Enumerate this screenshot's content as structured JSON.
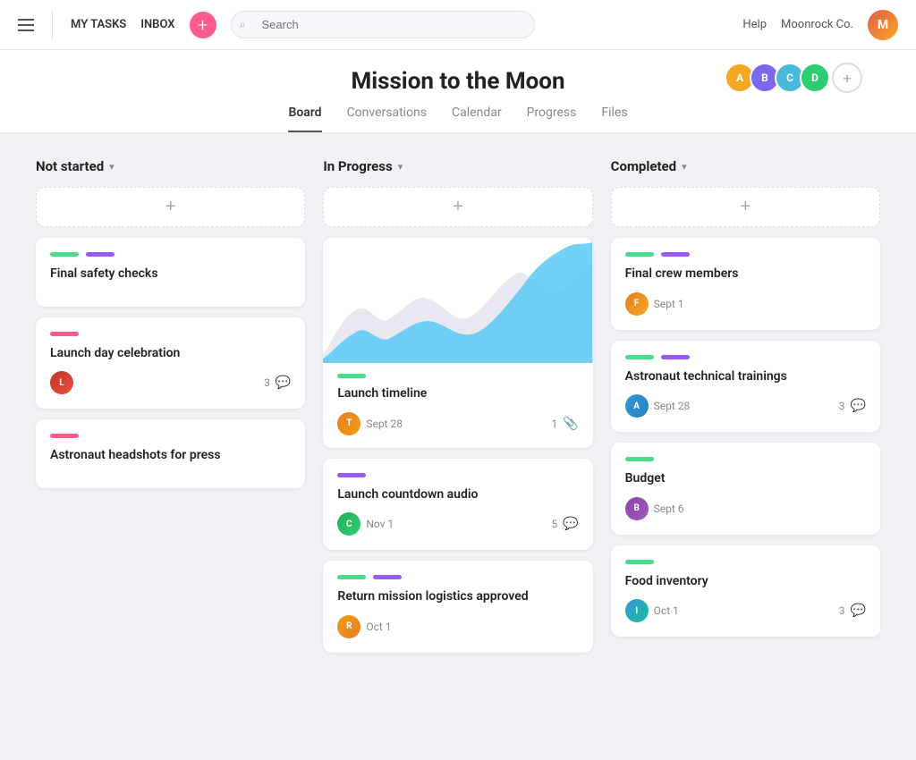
{
  "nav": {
    "my_tasks": "MY TASKS",
    "inbox": "INBOX",
    "add_icon": "+",
    "search_placeholder": "Search",
    "help": "Help",
    "company": "Moonrock Co.",
    "user_initials": "M"
  },
  "project": {
    "title": "Mission to the Moon",
    "tabs": [
      "Board",
      "Conversations",
      "Calendar",
      "Progress",
      "Files"
    ],
    "active_tab": 0,
    "avatars": [
      {
        "bg": "#f5a623",
        "initials": "A"
      },
      {
        "bg": "#7b68ee",
        "initials": "B"
      },
      {
        "bg": "#4ab8d8",
        "initials": "C"
      },
      {
        "bg": "#2ecc71",
        "initials": "D"
      }
    ]
  },
  "columns": [
    {
      "id": "not-started",
      "title": "Not started",
      "cards": [
        {
          "tags": [
            "green",
            "purple"
          ],
          "title": "Final safety checks",
          "avatar_bg": null,
          "date": null,
          "count": null,
          "icon": null
        },
        {
          "tags": [
            "pink"
          ],
          "title": "Launch day celebration",
          "avatar_bg": "#c0392b",
          "avatar_initials": "L",
          "date": null,
          "count": "3",
          "icon": "comment"
        },
        {
          "tags": [
            "pink"
          ],
          "title": "Astronaut headshots for press",
          "avatar_bg": null,
          "date": null,
          "count": null,
          "icon": null
        }
      ]
    },
    {
      "id": "in-progress",
      "title": "In Progress",
      "cards": [
        {
          "type": "chart",
          "tags": [
            "green"
          ],
          "title": "Launch timeline",
          "avatar_bg": "#e67e22",
          "avatar_initials": "T",
          "date": "Sept 28",
          "count": "1",
          "icon": "attach"
        },
        {
          "tags": [
            "purple"
          ],
          "title": "Launch countdown audio",
          "avatar_bg": "#27ae60",
          "avatar_initials": "C",
          "date": "Nov 1",
          "count": "5",
          "icon": "comment"
        },
        {
          "tags": [
            "green",
            "purple"
          ],
          "title": "Return mission logistics approved",
          "avatar_bg": "#f39c12",
          "avatar_initials": "R",
          "date": "Oct 1",
          "count": null,
          "icon": null
        }
      ]
    },
    {
      "id": "completed",
      "title": "Completed",
      "cards": [
        {
          "tags": [
            "green",
            "purple"
          ],
          "title": "Final crew members",
          "avatar_bg": "#e67e22",
          "avatar_initials": "F",
          "date": "Sept 1",
          "count": null,
          "icon": null
        },
        {
          "tags": [
            "green",
            "purple"
          ],
          "title": "Astronaut technical trainings",
          "avatar_bg": "#3498db",
          "avatar_initials": "A",
          "date": "Sept 28",
          "count": "3",
          "icon": "comment"
        },
        {
          "tags": [
            "green"
          ],
          "title": "Budget",
          "avatar_bg": "#8e44ad",
          "avatar_initials": "B",
          "date": "Sept 6",
          "count": null,
          "icon": null
        },
        {
          "tags": [
            "green"
          ],
          "title": "Food inventory",
          "avatar_bg": "#3498db",
          "avatar_initials": "I",
          "date": "Oct 1",
          "count": "3",
          "icon": "comment"
        }
      ]
    }
  ],
  "add_card_label": "+",
  "icons": {
    "comment": "💬",
    "attach": "📎",
    "search": "🔍"
  }
}
